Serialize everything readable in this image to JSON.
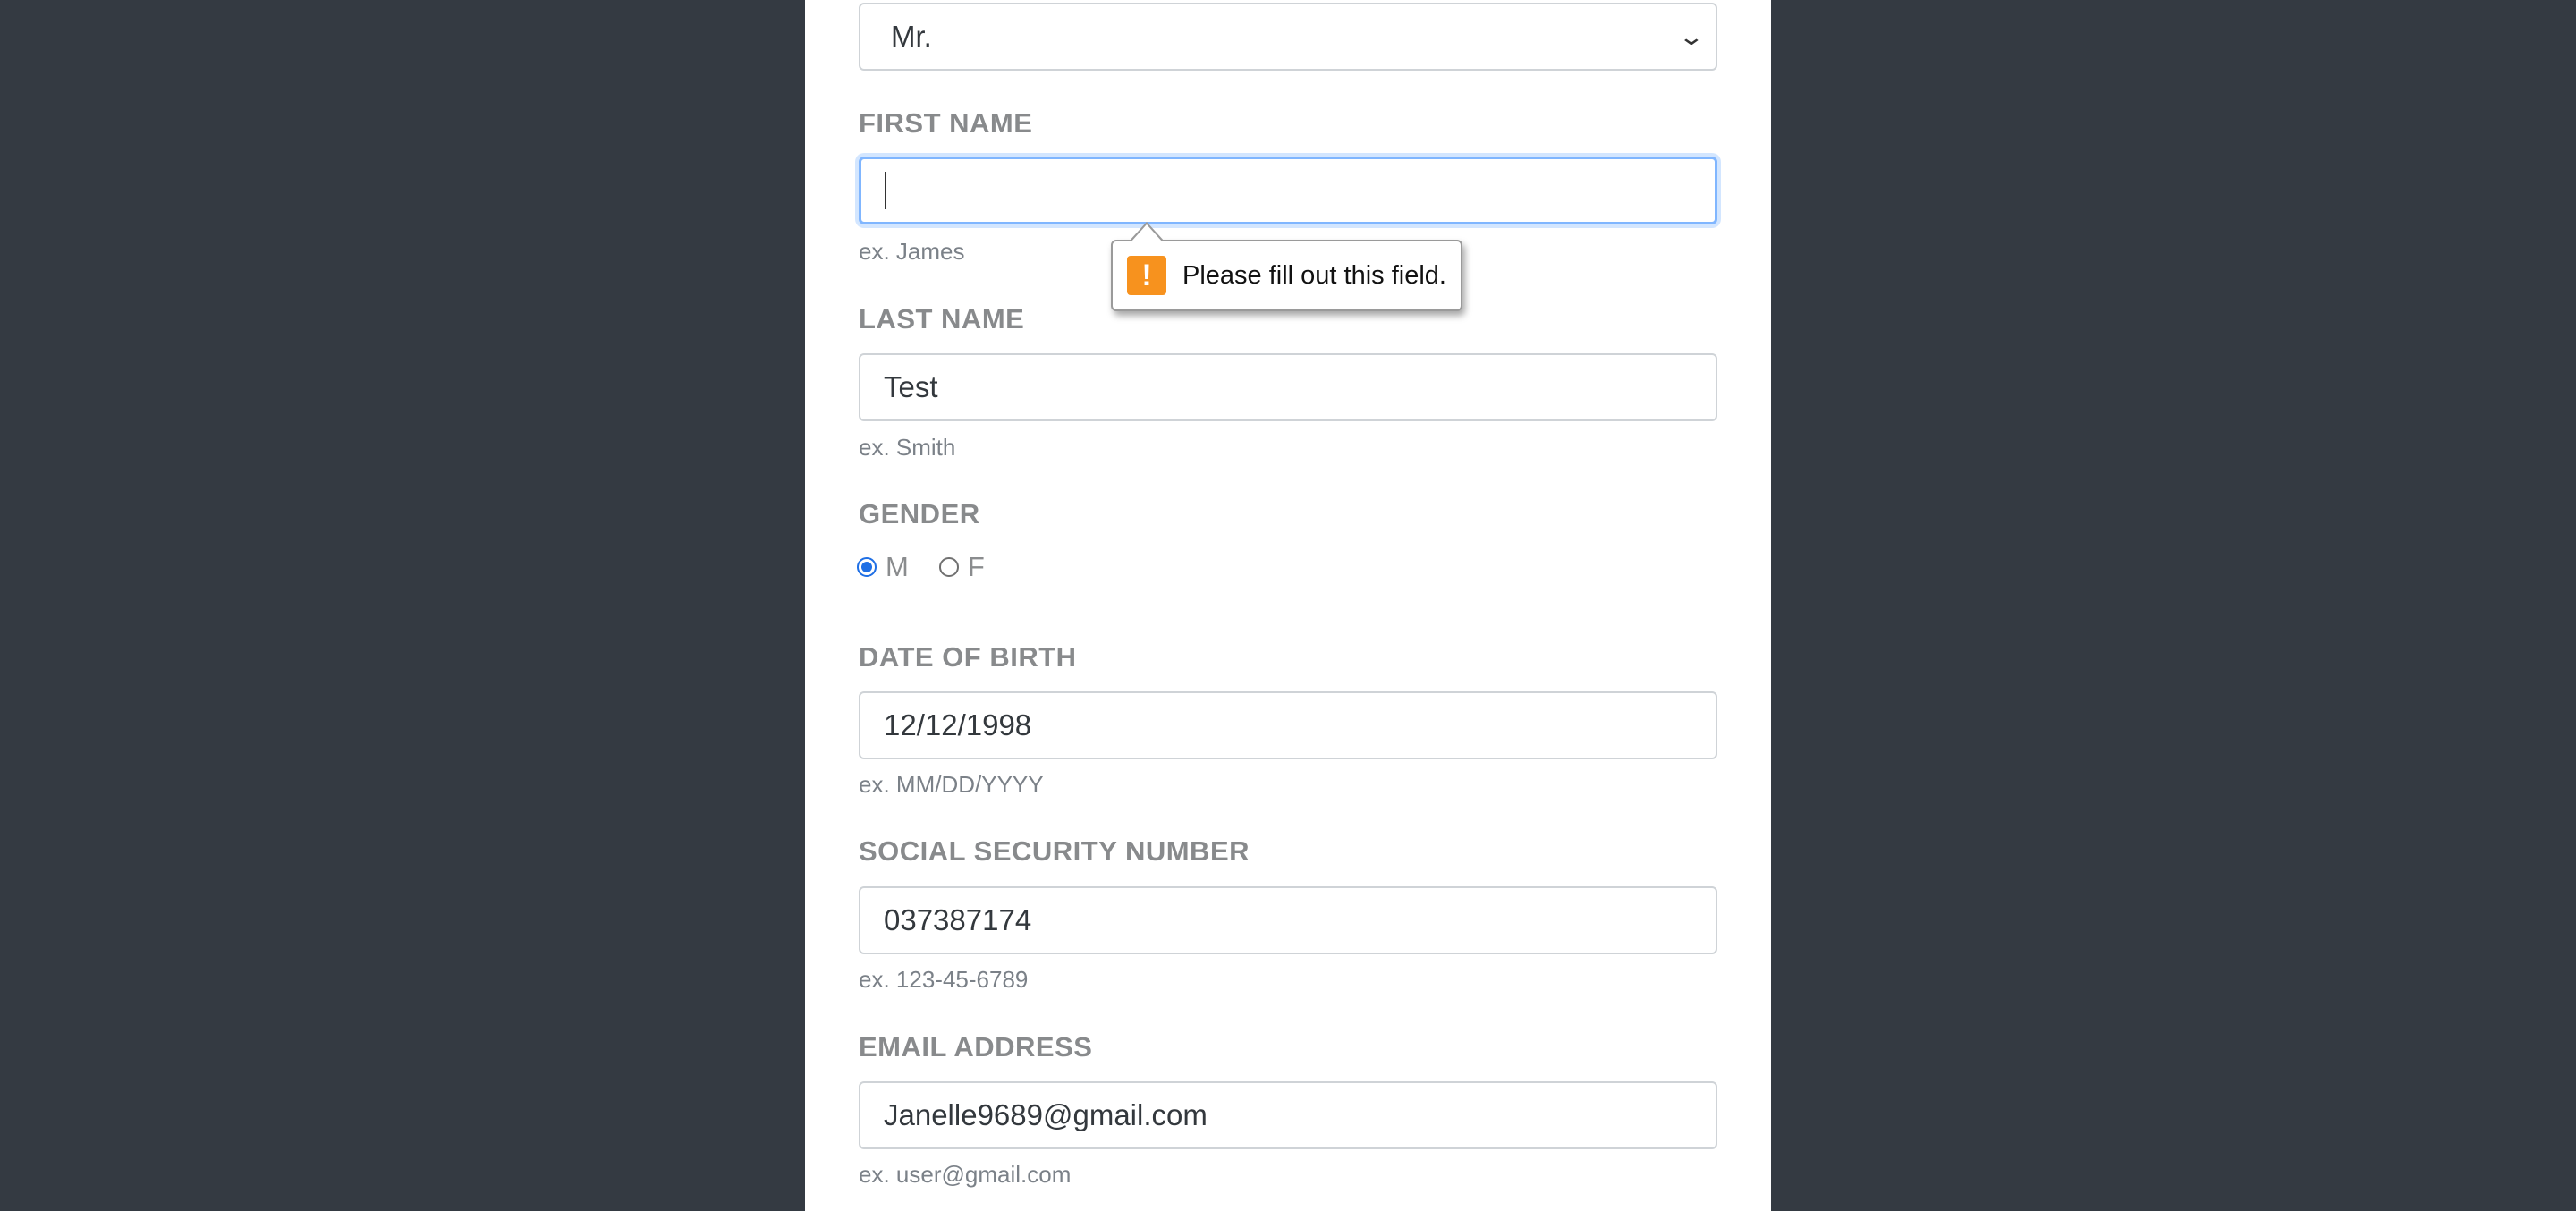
{
  "form": {
    "title_select": {
      "value": "Mr."
    },
    "first_name": {
      "label": "FIRST NAME",
      "value": "",
      "hint": "ex. James"
    },
    "last_name": {
      "label": "LAST NAME",
      "value": "Test",
      "hint": "ex. Smith"
    },
    "gender": {
      "label": "GENDER",
      "options": [
        "M",
        "F"
      ],
      "selected": "M"
    },
    "dob": {
      "label": "DATE OF BIRTH",
      "value": "12/12/1998",
      "hint": "ex. MM/DD/YYYY"
    },
    "ssn": {
      "label": "SOCIAL SECURITY NUMBER",
      "value": "037387174",
      "hint": "ex. 123-45-6789"
    },
    "email": {
      "label": "EMAIL ADDRESS",
      "value": "Janelle9689@gmail.com",
      "hint": "ex. user@gmail.com"
    }
  },
  "validation_tooltip": {
    "icon": "warning-icon",
    "icon_glyph": "!",
    "message": "Please fill out this field."
  },
  "colors": {
    "background": "#343a42",
    "panel": "#ffffff",
    "focus_ring": "#80b6ff",
    "warning": "#f7921e",
    "radio_selected": "#1f6fe5"
  }
}
